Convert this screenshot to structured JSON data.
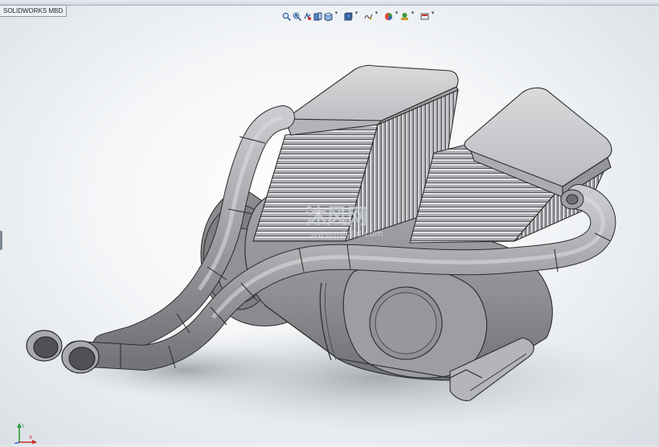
{
  "viewport": {
    "tab_label": "SOLIDWORKS MBD",
    "background_top": "#ffffff",
    "background_edge": "#d9dee4"
  },
  "heads_up_toolbar": {
    "icons": [
      "zoom-to-fit-icon",
      "zoom-to-area-icon",
      "previous-view-icon",
      "section-view-icon",
      "view-orientation-icon",
      "display-style-icon",
      "hide-show-items-icon",
      "edit-appearance-icon",
      "apply-scene-icon",
      "view-settings-icon"
    ]
  },
  "watermark": {
    "brand": "沐风网",
    "url": "www.mfcad.com"
  },
  "model": {
    "part_color": "#9a9c9f",
    "edge_color": "#2b2b2b"
  },
  "triad": {
    "axis_y": "Y",
    "axis_x": "X"
  }
}
